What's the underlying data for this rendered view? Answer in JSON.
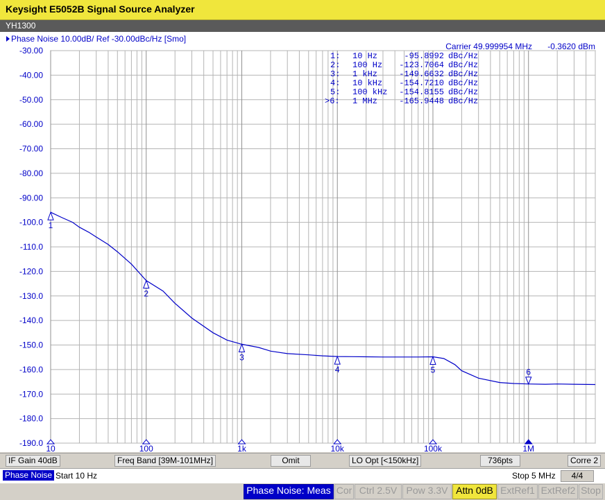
{
  "window": {
    "title": "Keysight E5052B Signal Source Analyzer"
  },
  "channel": {
    "name": "YH1300"
  },
  "trace": {
    "header": "Phase Noise 10.00dB/ Ref -30.00dBc/Hz [Smo]",
    "carrier": "Carrier 49.999954 MHz",
    "power": "-0.3620 dBm"
  },
  "markers": [
    {
      "num": "1:",
      "freq": "10 Hz",
      "value": "-95.8992",
      "unit": "dBc/Hz"
    },
    {
      "num": "2:",
      "freq": "100 Hz",
      "value": "-123.7064",
      "unit": "dBc/Hz"
    },
    {
      "num": "3:",
      "freq": "1 kHz",
      "value": "-149.6632",
      "unit": "dBc/Hz"
    },
    {
      "num": "4:",
      "freq": "10 kHz",
      "value": "-154.7210",
      "unit": "dBc/Hz"
    },
    {
      "num": "5:",
      "freq": "100 kHz",
      "value": "-154.8155",
      "unit": "dBc/Hz"
    },
    {
      "num": ">6:",
      "freq": "1 MHz",
      "value": "-165.9448",
      "unit": "dBc/Hz"
    }
  ],
  "chart_data": {
    "type": "line",
    "x_scale": "log",
    "xlim": [
      10,
      5000000
    ],
    "ylim": [
      -190,
      -30
    ],
    "yticks": [
      "-30.00",
      "-40.00",
      "-50.00",
      "-60.00",
      "-70.00",
      "-80.00",
      "-90.00",
      "-100.0",
      "-110.0",
      "-120.0",
      "-130.0",
      "-140.0",
      "-150.0",
      "-160.0",
      "-170.0",
      "-180.0",
      "-190.0"
    ],
    "xticks": [
      {
        "x": 10,
        "label": "10"
      },
      {
        "x": 100,
        "label": "100"
      },
      {
        "x": 1000,
        "label": "1k"
      },
      {
        "x": 10000,
        "label": "10k"
      },
      {
        "x": 100000,
        "label": "100k"
      },
      {
        "x": 1000000,
        "label": "1M"
      }
    ],
    "grid": true,
    "series": [
      {
        "x": [
          10,
          13,
          17,
          20,
          25,
          30,
          40,
          50,
          70,
          100,
          150,
          200,
          300,
          500,
          700,
          1000,
          1500,
          2000,
          3000,
          5000,
          7000,
          10000,
          20000,
          30000,
          50000,
          70000,
          100000,
          130000,
          170000,
          200000,
          300000,
          500000,
          700000,
          1000000,
          1500000,
          2000000,
          3000000,
          5000000
        ],
        "y": [
          -95.9,
          -98,
          -100,
          -102,
          -104,
          -106,
          -109,
          -112,
          -117,
          -123.7,
          -128,
          -133,
          -139,
          -145,
          -148,
          -149.7,
          -151,
          -152.5,
          -153.5,
          -154,
          -154.4,
          -154.7,
          -154.8,
          -154.9,
          -154.9,
          -154.9,
          -154.8,
          -155.5,
          -158,
          -160.5,
          -163.5,
          -165.3,
          -165.7,
          -165.9,
          -166,
          -165.9,
          -166,
          -166.1
        ]
      }
    ],
    "marker_points": [
      {
        "label": "1",
        "x": 10,
        "y": -95.9
      },
      {
        "label": "2",
        "x": 100,
        "y": -123.7
      },
      {
        "label": "3",
        "x": 1000,
        "y": -149.7
      },
      {
        "label": "4",
        "x": 10000,
        "y": -154.7
      },
      {
        "label": "5",
        "x": 100000,
        "y": -154.8
      },
      {
        "label": "6",
        "x": 1000000,
        "y": -165.9
      }
    ]
  },
  "status": {
    "if_gain": "IF Gain 40dB",
    "freq_band": "Freq Band [39M-101MHz]",
    "omit": "Omit",
    "lo_opt": "LO Opt [<150kHz]",
    "points": "736pts",
    "corre": "Corre 2"
  },
  "measure": {
    "mode": "Phase Noise",
    "start": "Start 10 Hz",
    "stop": "Stop 5 MHz",
    "page": "4/4"
  },
  "softkeys": {
    "meas": "Phase Noise: Meas",
    "cor": "Cor",
    "ctrl": "Ctrl 2.5V",
    "pow": "Pow 3.3V",
    "attn": "Attn 0dB",
    "extref1": "ExtRef1",
    "extref2": "ExtRef2",
    "stop": "Stop"
  },
  "colors": {
    "trace": "#0000c8",
    "grid": "#b4b4b4",
    "titlebar": "#f0e63c",
    "highlight": "#0000c8"
  }
}
